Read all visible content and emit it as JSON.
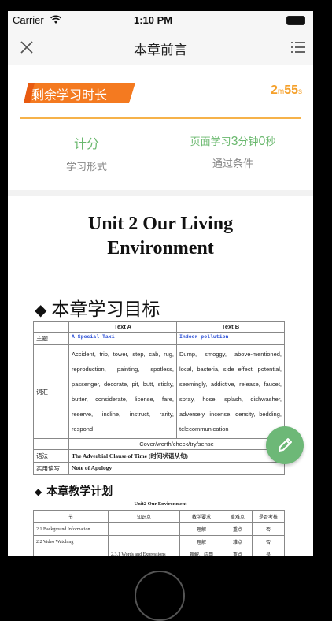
{
  "status": {
    "carrier": "Carrier",
    "time": "1:10 PM"
  },
  "nav": {
    "title": "本章前言"
  },
  "timer": {
    "label": "剩余学习时长",
    "minutes": "2",
    "m_unit": "m",
    "seconds": "55",
    "s_unit": "s"
  },
  "stats": {
    "left_main": "计分",
    "left_sub": "学习形式",
    "right_main_prefix": "页面学习",
    "right_main_num1": "3",
    "right_main_mid": "分钟",
    "right_main_num2": "0",
    "right_main_suffix": "秒",
    "right_sub": "通过条件"
  },
  "doc": {
    "title_line1": "Unit 2 Our Living",
    "title_line2": "Environment",
    "section1": "本章学习目标",
    "section2": "本章教学计划"
  },
  "goals_table": {
    "col_a": "Text A",
    "col_b": "Text B",
    "theme_label": "主题",
    "theme_a": "A Special Taxi",
    "theme_b": "Indoor pollution",
    "vocab_label": "词汇",
    "vocab_a": "Accident, trip, tower, step, cab, rug, reproduction, painting, spotless, passenger, decorate, pit, butt, sticky, butter, considerate, license, fare, reserve, incline, instruct, rarity, respond",
    "vocab_b": "Dump, smoggy, above-mentioned, local, bacteria, side effect, potential, seemingly, addictive, release, faucet, spray, hose, splash, dishwasher, adversely, incense, density, bedding, telecommunication",
    "shared_words": "Cover/worth/check/try/sense",
    "grammar_label": "语法",
    "grammar": "The Adverbial Clause of Time (时间状语从句)",
    "writing_label": "实用读写",
    "writing": "Note of Apology"
  },
  "plan_table": {
    "title": "Unit2 Our Environment",
    "headers": [
      "节",
      "知识点",
      "教学要求",
      "重难点",
      "是否考核"
    ],
    "rows": [
      [
        "2.1 Background Information",
        "",
        "理解",
        "重点",
        "否"
      ],
      [
        "2.2 Video Watching",
        "",
        "理解",
        "难点",
        "否"
      ],
      [
        "",
        "2.3.1 Words and Expressions",
        "理解、应用",
        "重点",
        "是"
      ]
    ]
  }
}
